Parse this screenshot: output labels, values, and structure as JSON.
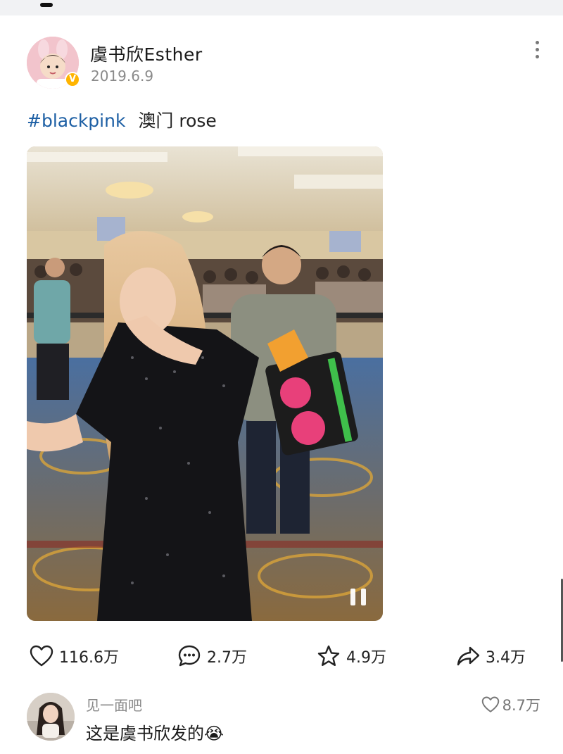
{
  "post": {
    "author": "虞书欣Esther",
    "date": "2019.6.9",
    "verified_icon": "verified-v-badge",
    "text": {
      "hashtag": "#blackpink",
      "rest": "澳门 rose"
    }
  },
  "media": {
    "type": "video",
    "state": "playing",
    "control_icon": "pause-icon"
  },
  "actions": {
    "like": {
      "icon": "heart-icon",
      "count": "116.6万"
    },
    "comment": {
      "icon": "comment-bubble-icon",
      "count": "2.7万"
    },
    "favorite": {
      "icon": "star-icon",
      "count": "4.9万"
    },
    "share": {
      "icon": "share-arrow-icon",
      "count": "3.4万"
    }
  },
  "top_comment": {
    "user": "见一面吧",
    "text": "这是虞书欣发的",
    "emoji": "😭",
    "likes": "8.7万"
  },
  "colors": {
    "hashtag": "#1d5fa4",
    "verified": "#ffb400",
    "muted_text": "#8a8a8a"
  }
}
